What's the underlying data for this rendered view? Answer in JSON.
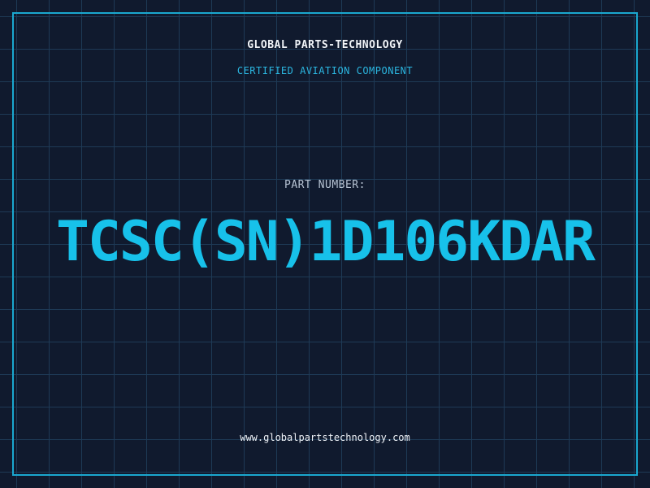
{
  "header": {
    "company": "GLOBAL PARTS-TECHNOLOGY",
    "tagline": "CERTIFIED AVIATION COMPONENT"
  },
  "part": {
    "label": "PART NUMBER:",
    "number": "TCSC(SN)1D106KDAR"
  },
  "footer": {
    "website": "www.globalpartstechnology.com"
  },
  "colors": {
    "background": "#101a2e",
    "grid": "#1e3a56",
    "accent": "#17c1ea",
    "frame": "#1aa7cf"
  }
}
